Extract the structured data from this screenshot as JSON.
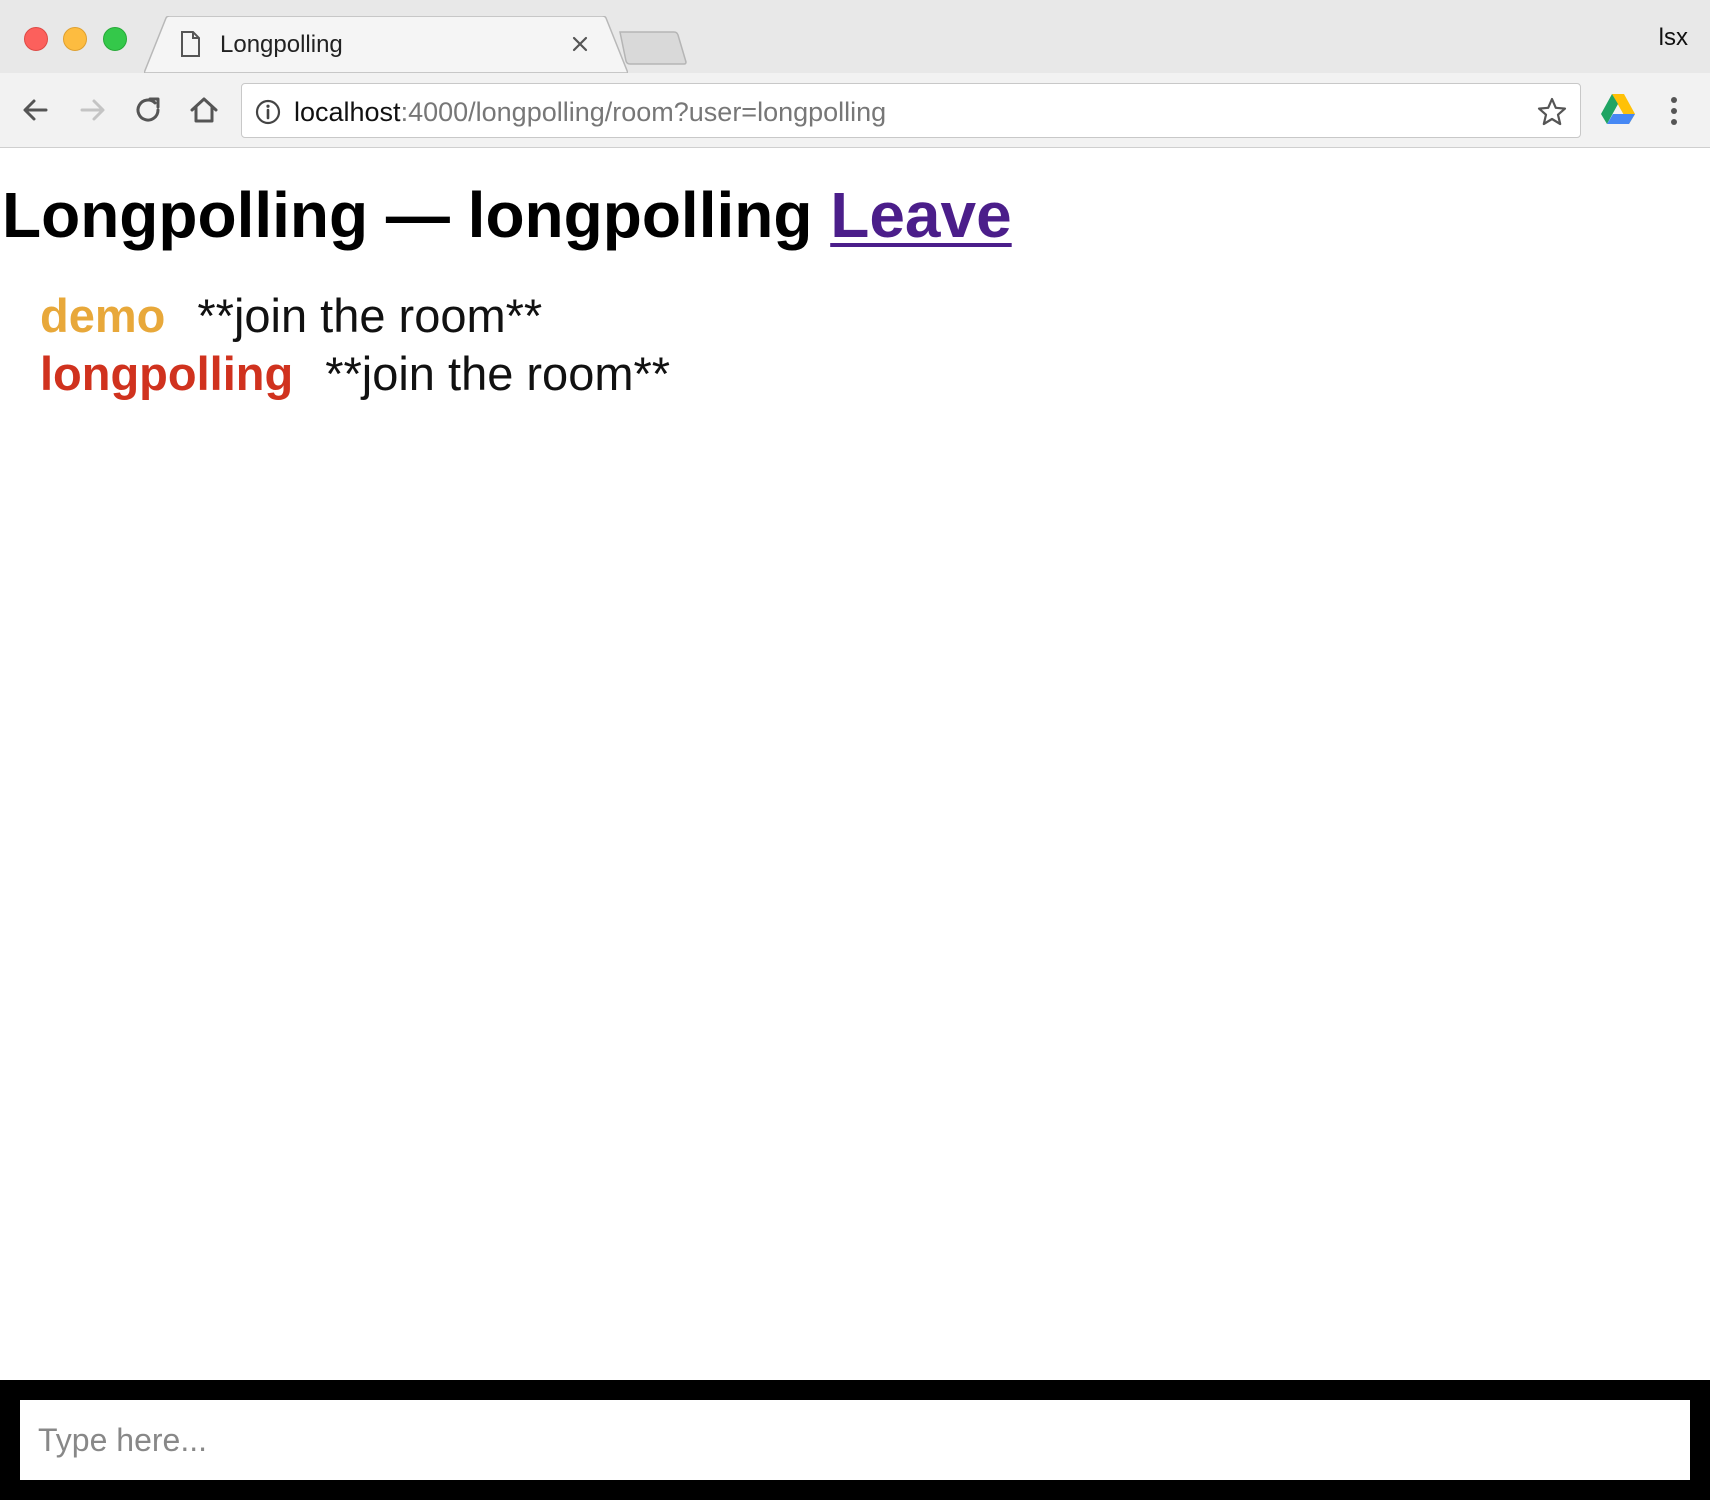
{
  "browser": {
    "tab_title": "Longpolling",
    "profile_name": "lsx",
    "url_host": "localhost",
    "url_rest": ":4000/longpolling/room?user=longpolling",
    "icons": {
      "back": "back-arrow-icon",
      "forward": "forward-arrow-icon",
      "reload": "reload-icon",
      "home": "home-icon",
      "info": "info-icon",
      "bookmark": "star-icon",
      "extension": "drive-icon",
      "menu": "vertical-dots-icon",
      "page": "page-icon",
      "close": "close-icon"
    }
  },
  "page": {
    "title": "Longpolling — longpolling",
    "leave_label": "Leave",
    "link_color": "#4b1e8a",
    "messages": [
      {
        "user": "demo",
        "text": "**join the room**",
        "color": "#e8a83a"
      },
      {
        "user": "longpolling",
        "text": "**join the room**",
        "color": "#d0321e"
      }
    ]
  },
  "input": {
    "placeholder": "Type here...",
    "value": ""
  }
}
